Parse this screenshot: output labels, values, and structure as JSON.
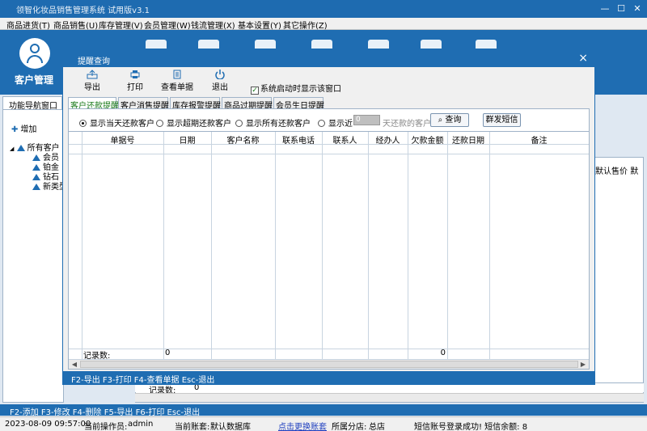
{
  "window": {
    "title": "领智化妆品销售管理系统  试用版v3.1",
    "controls": [
      "—",
      "☐",
      "✕"
    ]
  },
  "menu": [
    "商品进货(T)",
    "商品销售(U)",
    "库存管理(V)",
    "会员管理(W)",
    "钱流管理(X)",
    "基本设置(Y)",
    "其它操作(Z)"
  ],
  "module": {
    "label": "客户管理",
    "icon": "customer-icon"
  },
  "nav": {
    "tab": "功能导航窗口",
    "add_button": "增加",
    "tree_root": "所有客户",
    "tree_items": [
      "会员",
      "铂金",
      "钻石",
      "新类型"
    ]
  },
  "background_grid": {
    "visible_header": "默认售价",
    "visible_header_extra": "默",
    "record_label": "记录数:",
    "record_count": "0"
  },
  "shortcut_bar": "F2-添加  F3-修改  F4-删除  F5-导出  F6-打印  Esc-退出",
  "status": {
    "datetime": "2023-08-09  09:57:00",
    "operator_label": "当前操作员:",
    "operator": "admin",
    "account_label": "当前账套:",
    "account": "默认数据库",
    "switch_link": "点击更换账套",
    "branch_label": "所属分店:",
    "branch": "总店",
    "sms": "短信账号登录成功!  短信余额: 8"
  },
  "dialog": {
    "title": "提醒查询",
    "close": "×",
    "toolbar": {
      "export": "导出",
      "print": "打印",
      "view": "查看单据",
      "exit": "退出"
    },
    "show_on_start": "系统启动时显示该窗口",
    "tabs": [
      "客户还款提醒",
      "客户消售提醒",
      "库存报警提醒",
      "商品过期提醒",
      "会员生日提醒"
    ],
    "filters": {
      "today": "显示当天还款客户",
      "overdue": "显示超期还款客户",
      "all": "显示所有还款客户",
      "recent": "显示近",
      "days_value": "0",
      "days_suffix": "天还款的客户",
      "query": "查询",
      "sms": "群发短信"
    },
    "columns": [
      "单据号",
      "日期",
      "客户名称",
      "联系电话",
      "联系人",
      "经办人",
      "欠款金额",
      "还款日期",
      "备注"
    ],
    "footer": {
      "record_label": "记录数:",
      "record_count": "0",
      "amount_total": "0"
    },
    "shortcuts": "F2-导出  F3-打印  F4-查看单据  Esc-退出"
  }
}
